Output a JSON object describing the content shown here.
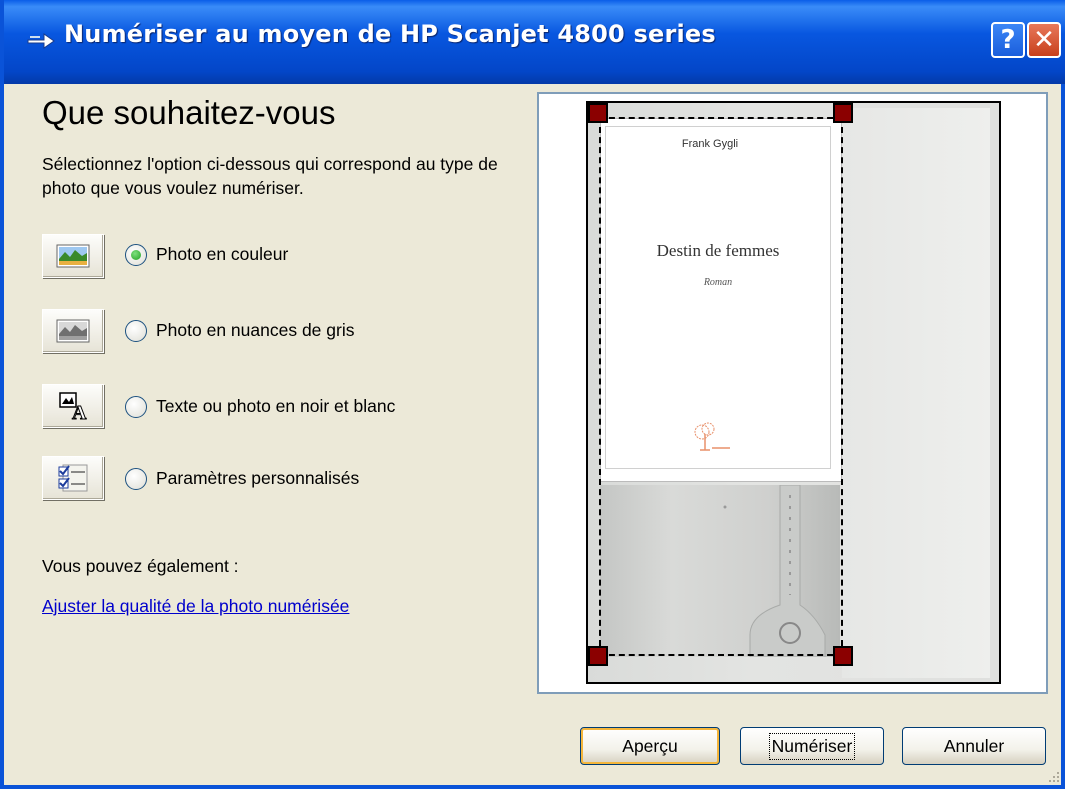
{
  "window": {
    "title": "Numériser au moyen de HP Scanjet 4800 series"
  },
  "titlebar_buttons": {
    "help": "?",
    "close": "✕"
  },
  "heading": "Que souhaitez-vous",
  "description": "Sélectionnez l'option ci-dessous qui correspond au type de photo que vous voulez numériser.",
  "options": [
    {
      "label": "Photo en couleur",
      "selected": true,
      "icon": "color-photo-icon"
    },
    {
      "label": "Photo en nuances de gris",
      "selected": false,
      "icon": "grayscale-photo-icon"
    },
    {
      "label": "Texte ou photo en noir et blanc",
      "selected": false,
      "icon": "black-white-text-icon"
    },
    {
      "label": "Paramètres personnalisés",
      "selected": false,
      "icon": "custom-settings-icon"
    }
  ],
  "also_label": "Vous pouvez également :",
  "adjust_link": "Ajuster la qualité de la photo numérisée",
  "preview": {
    "author": "Frank Gygli",
    "book_title": "Destin de femmes",
    "book_subtitle": "Roman"
  },
  "buttons": {
    "preview": "Aperçu",
    "scan": "Numériser",
    "cancel": "Annuler"
  },
  "colors": {
    "titlebar": "#0a53d8",
    "dialog_bg": "#ece9d8",
    "link": "#0000cc",
    "crop_handle": "#8b0000",
    "radio_dot": "#21a121"
  }
}
